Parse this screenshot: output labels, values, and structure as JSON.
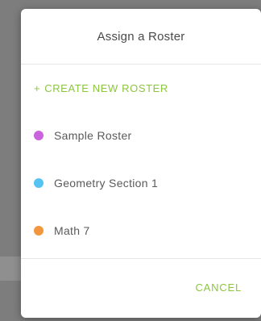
{
  "dialog": {
    "title": "Assign a Roster",
    "create_label": "CREATE NEW ROSTER",
    "create_icon": "+",
    "cancel_label": "CANCEL",
    "accent_color": "#8cc63f",
    "rosters": [
      {
        "label": "Sample Roster",
        "color": "#c964dc"
      },
      {
        "label": "Geometry Section 1",
        "color": "#55c4f2"
      },
      {
        "label": "Math 7",
        "color": "#f2973e"
      }
    ]
  }
}
